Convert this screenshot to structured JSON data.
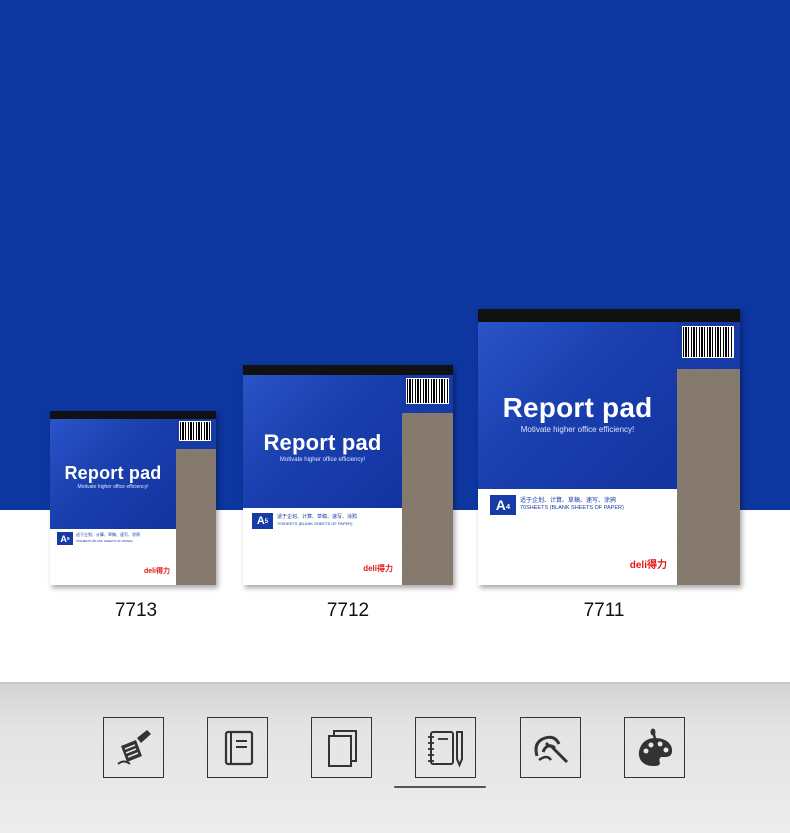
{
  "colors": {
    "brand_blue": "#0d36a0",
    "cover_blue": "#1a3fae",
    "kraft": "#84776b",
    "brand_red": "#e01818"
  },
  "products": [
    {
      "title": "Report pad",
      "subtitle": "Motivate higher office efficiency!",
      "size": "A",
      "size_num": "6",
      "desc_cn": "适于企划、计算、草稿、速写、涂鸦",
      "desc_en": "70SHEETS (BLANK SHEETS OF PAPER)",
      "brand": "deli得力",
      "model": "7713"
    },
    {
      "title": "Report pad",
      "subtitle": "Motivate higher office efficiency!",
      "size": "A",
      "size_num": "5",
      "desc_cn": "适于企划、计算、草稿、速写、涂鸦",
      "desc_en": "70SHEETS (BLANK SHEETS OF PAPER)",
      "brand": "deli得力",
      "model": "7712"
    },
    {
      "title": "Report pad",
      "subtitle": "Motivate higher office efficiency!",
      "size": "A",
      "size_num": "4",
      "desc_cn": "适于企划、计算、草稿、速写、涂鸦",
      "desc_en": "70SHEETS (BLANK SHEETS OF PAPER)",
      "brand": "deli得力",
      "model": "7711"
    }
  ],
  "usage_icons": [
    {
      "name": "writing-icon",
      "active": false
    },
    {
      "name": "notebook-icon",
      "active": false
    },
    {
      "name": "sheets-icon",
      "active": false
    },
    {
      "name": "spiral-notebook-pencil-icon",
      "active": true
    },
    {
      "name": "brush-drawing-icon",
      "active": false
    },
    {
      "name": "paint-palette-icon",
      "active": false
    }
  ]
}
